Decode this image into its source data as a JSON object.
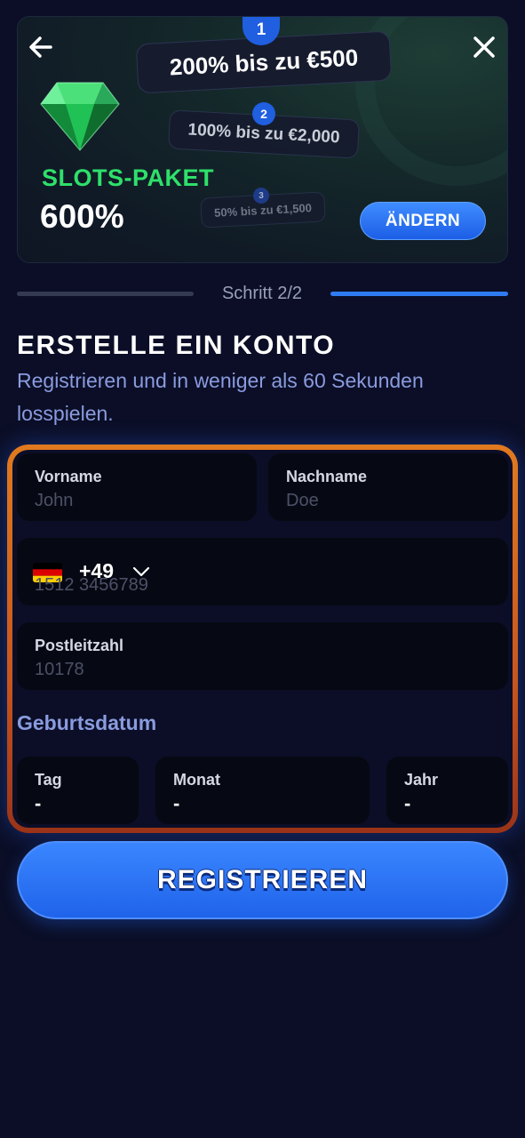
{
  "banner": {
    "tiers": [
      {
        "number": "1",
        "text": "200% bis zu €500"
      },
      {
        "number": "2",
        "text": "100% bis zu €2,000"
      },
      {
        "number": "3",
        "text": "50% bis zu €1,500"
      }
    ],
    "package_label": "SLOTS-PAKET",
    "package_value": "600%",
    "change_button": "ÄNDERN",
    "icons": {
      "back": "arrow-left-icon",
      "close": "close-icon",
      "gem": "emerald-gem-icon"
    }
  },
  "stepper": {
    "text": "Schritt 2/2",
    "current": 2,
    "total": 2
  },
  "header": {
    "title": "ERSTELLE EIN KONTO",
    "subtitle": "Registrieren und in weniger als 60 Sekunden losspielen."
  },
  "form": {
    "first_name": {
      "label": "Vorname",
      "placeholder": "John",
      "value": ""
    },
    "last_name": {
      "label": "Nachname",
      "placeholder": "Doe",
      "value": ""
    },
    "phone": {
      "country_code": "+49",
      "flag": "germany-flag-icon",
      "placeholder": "1512 3456789",
      "value": ""
    },
    "postal_code": {
      "label": "Postleitzahl",
      "placeholder": "10178",
      "value": ""
    },
    "birthdate": {
      "section_label": "Geburtsdatum",
      "day": {
        "label": "Tag",
        "value": "-"
      },
      "month": {
        "label": "Monat",
        "value": "-"
      },
      "year": {
        "label": "Jahr",
        "value": "-"
      }
    }
  },
  "submit_button": "REGISTRIEREN",
  "colors": {
    "background": "#0b0e26",
    "accent_blue": "#2f7bf4",
    "package_green": "#2ee06b",
    "form_border_orange": "#e07a1e",
    "subtitle_lilac": "#8a9bdf"
  }
}
